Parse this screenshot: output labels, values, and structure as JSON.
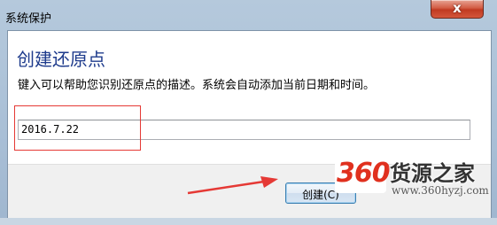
{
  "window": {
    "title": "系统保护",
    "close_glyph": "x"
  },
  "dialog": {
    "heading": "创建还原点",
    "description": "键入可以帮助您识别还原点的描述。系统会自动添加当前日期和时间。",
    "restore_point_name": "2016.7.22",
    "create_button_label": "创建(C)"
  },
  "watermark": {
    "number": "360",
    "name": "货源之家",
    "url": "www.360hyzj.com"
  },
  "colors": {
    "heading": "#1e3b8c",
    "highlight_box": "#e53935",
    "annotation_arrow": "#e53935",
    "close_button": "#c03a22"
  }
}
